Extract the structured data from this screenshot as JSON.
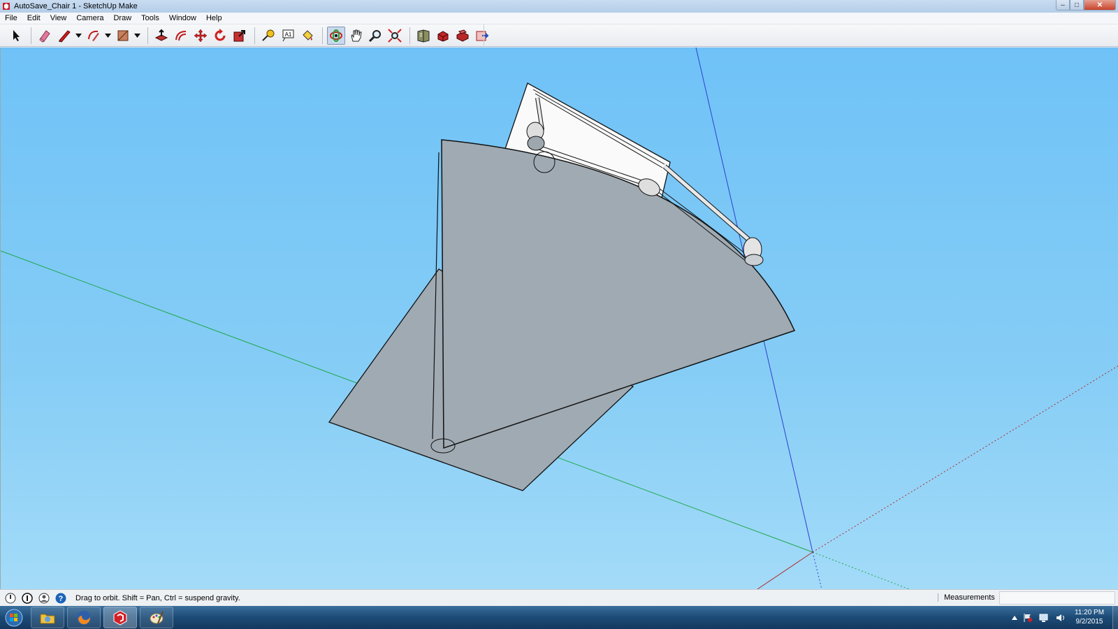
{
  "window": {
    "title": "AutoSave_Chair 1 - SketchUp Make",
    "controls": {
      "minimize": "–",
      "maximize": "□",
      "close": "✕"
    }
  },
  "menu": [
    "File",
    "Edit",
    "View",
    "Camera",
    "Draw",
    "Tools",
    "Window",
    "Help"
  ],
  "toolbar": {
    "tools": [
      {
        "name": "select-tool",
        "icon": "arrow-icon"
      },
      {
        "name": "eraser-tool",
        "icon": "eraser-icon"
      },
      {
        "name": "line-tool",
        "icon": "pencil-icon"
      },
      {
        "name": "arc-tool",
        "icon": "arc-icon"
      },
      {
        "name": "rectangle-tool",
        "icon": "rectangle-icon"
      },
      {
        "name": "push-pull-tool",
        "icon": "push-pull-icon"
      },
      {
        "name": "offset-tool",
        "icon": "offset-icon"
      },
      {
        "name": "move-tool",
        "icon": "move-icon"
      },
      {
        "name": "rotate-tool",
        "icon": "rotate-icon"
      },
      {
        "name": "scale-tool",
        "icon": "scale-icon"
      },
      {
        "name": "tape-measure-tool",
        "icon": "tape-icon"
      },
      {
        "name": "text-tool",
        "icon": "text-icon"
      },
      {
        "name": "paint-bucket-tool",
        "icon": "bucket-icon"
      },
      {
        "name": "orbit-tool",
        "icon": "orbit-icon",
        "active": true
      },
      {
        "name": "pan-tool",
        "icon": "hand-icon"
      },
      {
        "name": "zoom-tool",
        "icon": "magnifier-icon"
      },
      {
        "name": "zoom-extents-tool",
        "icon": "zoom-extents-icon"
      },
      {
        "name": "warehouse-button",
        "icon": "warehouse-icon"
      },
      {
        "name": "share-model-button",
        "icon": "share-icon"
      },
      {
        "name": "extension-warehouse-button",
        "icon": "extension-icon"
      },
      {
        "name": "send-to-layout-button",
        "icon": "layout-icon"
      }
    ],
    "text_tool_glyph": "A1"
  },
  "colors": {
    "sky": "#7cc8f7",
    "face": "#a0aab2",
    "face_light": "#fafafa",
    "green_axis": "#1fa84a",
    "blue_axis": "#2b3fd0",
    "red_axis": "#b02a2a",
    "edge": "#111111"
  },
  "status": {
    "message": "Drag to orbit. Shift = Pan, Ctrl = suspend gravity.",
    "measurements_label": "Measurements",
    "measurements_value": "",
    "help_glyph": "?"
  },
  "taskbar": {
    "apps": [
      "Windows Explorer",
      "Firefox",
      "SketchUp",
      "Paint"
    ],
    "time": "11:20 PM",
    "date": "9/2/2015"
  }
}
